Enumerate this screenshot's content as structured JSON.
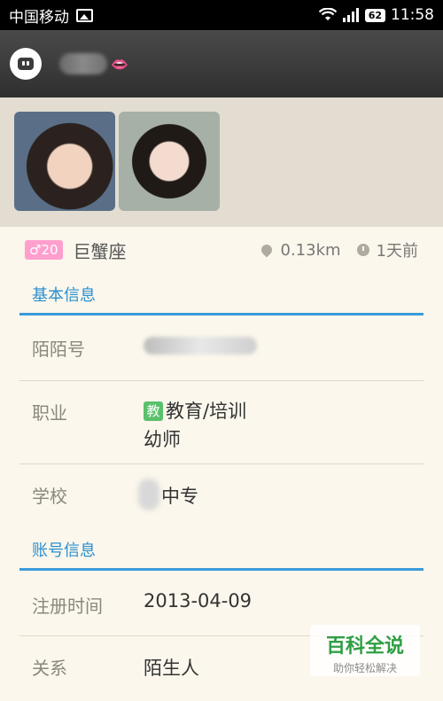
{
  "status_bar": {
    "carrier": "中国移动",
    "battery": "62",
    "time": "11:58"
  },
  "header": {
    "app_icon": "chat-bubble-icon",
    "name_emoji": "👄"
  },
  "photos": [
    "photo-1",
    "photo-2"
  ],
  "meta": {
    "age": "♂20",
    "zodiac": "巨蟹座",
    "distance": "0.13km",
    "last_seen": "1天前"
  },
  "basic_info": {
    "title": "基本信息",
    "momo_id_label": "陌陌号",
    "job_label": "职业",
    "job_badge": "教",
    "job_category": "教育/培训",
    "job_title": "幼师",
    "school_label": "学校",
    "school_value": "中专"
  },
  "account_info": {
    "title": "账号信息",
    "register_label": "注册时间",
    "register_value": "2013-04-09",
    "relation_label": "关系",
    "relation_value": "陌生人"
  },
  "watermark": {
    "main": "百科全说",
    "sub": "助你轻松解决"
  },
  "colors": {
    "accent": "#2a8fcf",
    "age_badge": "#ff9fcd",
    "edu_badge": "#5bc06b",
    "background": "#fbf7ec"
  }
}
